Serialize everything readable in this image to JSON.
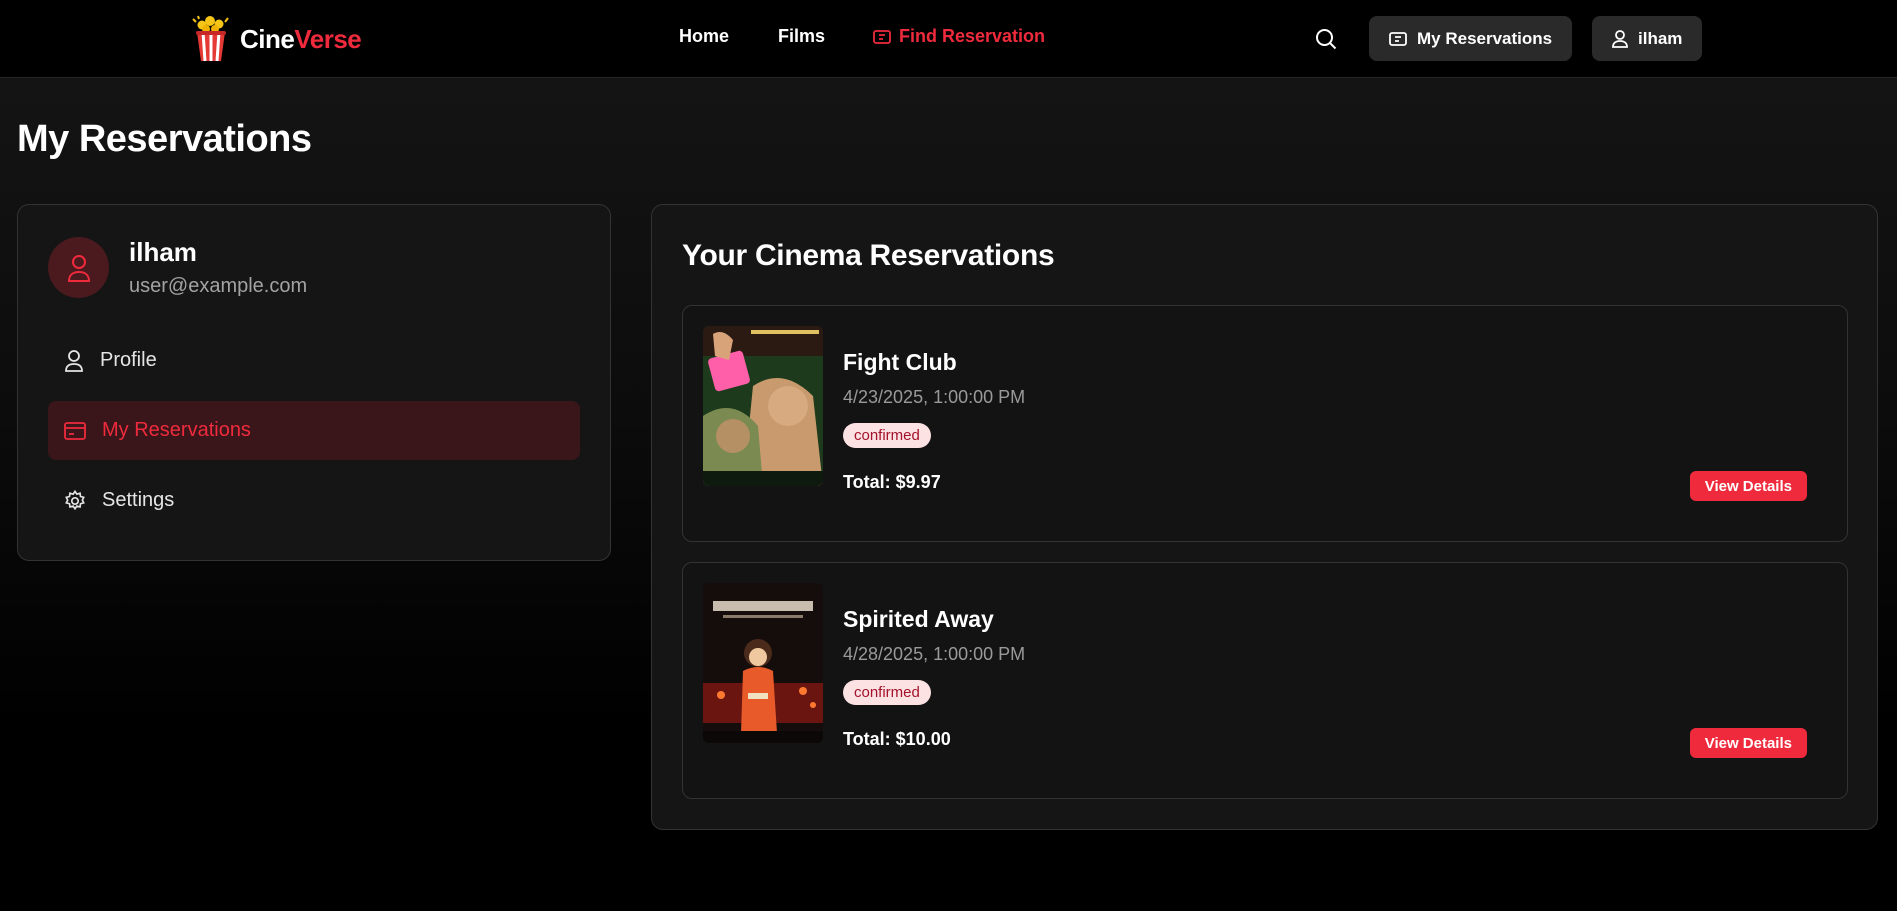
{
  "brand": {
    "name_part1": "Cine",
    "name_part2": "Verse"
  },
  "nav": [
    {
      "label": "Home",
      "icon": ""
    },
    {
      "label": "Films",
      "icon": ""
    },
    {
      "label": "Find Reservation",
      "icon": "ticket-icon",
      "active": true
    }
  ],
  "header_buttons": {
    "reservations_label": "My Reservations",
    "user_label": "ilham"
  },
  "page_title": "My Reservations",
  "sidebar": {
    "user_name": "ilham",
    "user_email": "user@example.com",
    "items": [
      {
        "label": "Profile",
        "icon": "user-icon"
      },
      {
        "label": "My Reservations",
        "icon": "card-icon",
        "active": true
      },
      {
        "label": "Settings",
        "icon": "gear-icon"
      }
    ]
  },
  "main": {
    "title": "Your Cinema Reservations",
    "reservations": [
      {
        "film": "Fight Club",
        "datetime": "4/23/2025, 1:00:00 PM",
        "status": "confirmed",
        "total": "Total: $9.97",
        "action": "View Details"
      },
      {
        "film": "Spirited Away",
        "datetime": "4/28/2025, 1:00:00 PM",
        "status": "confirmed",
        "total": "Total: $10.00",
        "action": "View Details"
      }
    ]
  },
  "colors": {
    "accent": "#ef2a3c",
    "background": "#000000",
    "panel": "#151515",
    "badge_bg": "#fde2e4",
    "badge_text": "#a3122a"
  }
}
